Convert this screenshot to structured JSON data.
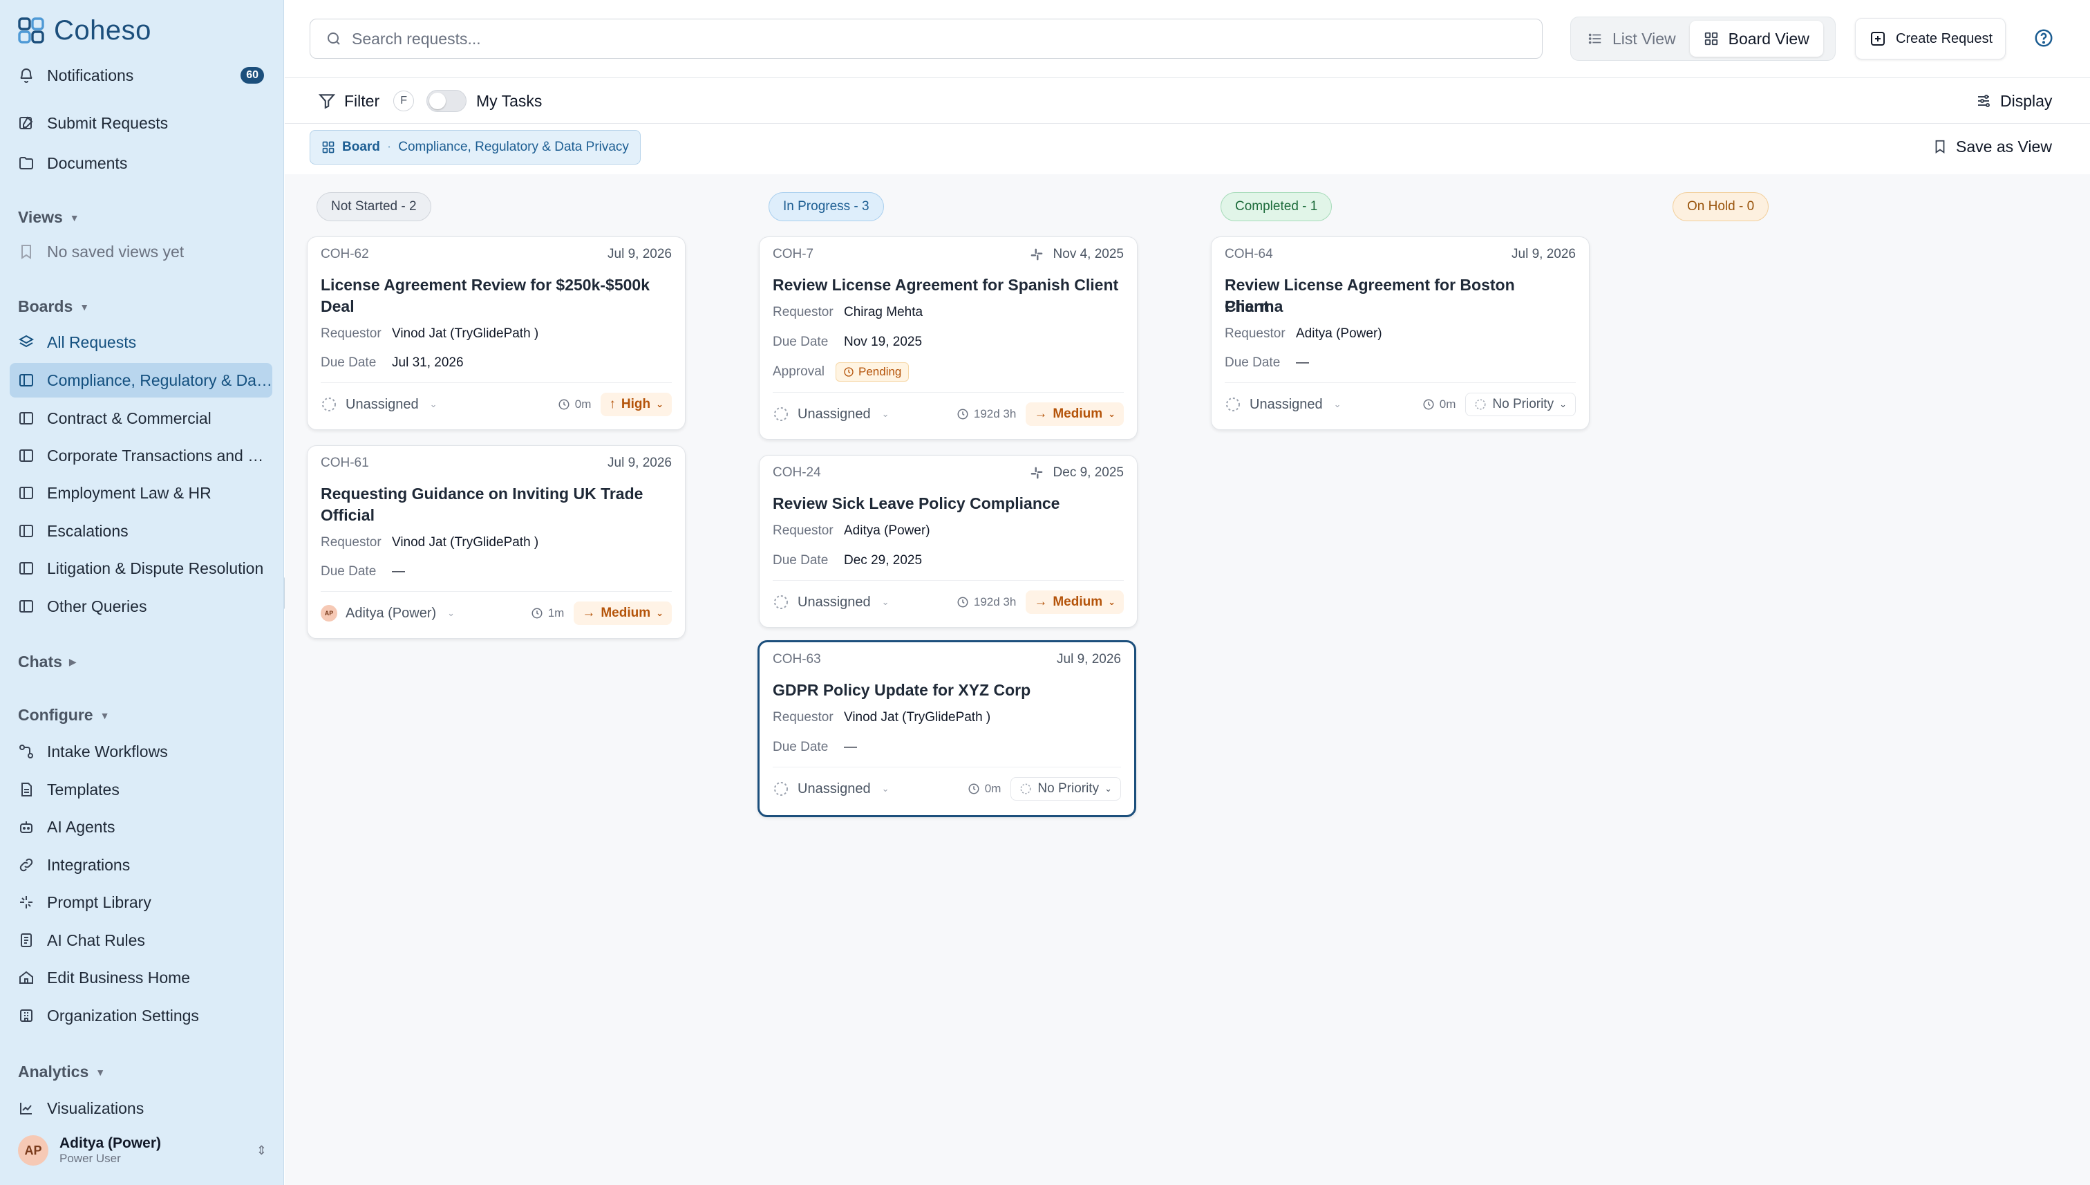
{
  "brand": {
    "name": "Coheso",
    "logo_icon": "coheso-logo-icon",
    "color": "#1c4f7c"
  },
  "sidebar": {
    "notifications": {
      "label": "Notifications",
      "count": "60"
    },
    "top_items": [
      {
        "label": "Submit Requests",
        "icon": "edit-icon"
      },
      {
        "label": "Documents",
        "icon": "folder-icon"
      }
    ],
    "views": {
      "heading": "Views",
      "empty": "No saved views yet"
    },
    "boards": {
      "heading": "Boards",
      "all_requests": "All Requests",
      "items": [
        {
          "label": "Compliance, Regulatory & Data Privacy",
          "active": true
        },
        {
          "label": "Contract & Commercial",
          "active": false
        },
        {
          "label": "Corporate Transactions and M&A",
          "active": false
        },
        {
          "label": "Employment Law & HR",
          "active": false
        },
        {
          "label": "Escalations",
          "active": false
        },
        {
          "label": "Litigation & Dispute Resolution",
          "active": false
        },
        {
          "label": "Other Queries",
          "active": false
        }
      ]
    },
    "chats": {
      "heading": "Chats"
    },
    "configure": {
      "heading": "Configure",
      "items": [
        {
          "label": "Intake Workflows",
          "icon": "workflow-icon"
        },
        {
          "label": "Templates",
          "icon": "template-icon"
        },
        {
          "label": "AI Agents",
          "icon": "robot-icon"
        },
        {
          "label": "Integrations",
          "icon": "link-icon"
        },
        {
          "label": "Prompt Library",
          "icon": "sparkle-icon"
        },
        {
          "label": "AI Chat Rules",
          "icon": "rules-icon"
        },
        {
          "label": "Edit Business Home",
          "icon": "home-icon"
        },
        {
          "label": "Organization Settings",
          "icon": "building-icon"
        }
      ]
    },
    "analytics": {
      "heading": "Analytics",
      "items": [
        {
          "label": "Visualizations",
          "icon": "chart-line-icon"
        }
      ]
    },
    "user": {
      "initials": "AP",
      "name": "Aditya (Power)",
      "role": "Power User"
    }
  },
  "topbar": {
    "search_placeholder": "Search requests...",
    "list_view": "List View",
    "board_view": "Board View",
    "create_request": "Create Request"
  },
  "filterbar": {
    "filter_label": "Filter",
    "filter_shortcut": "F",
    "my_tasks_label": "My Tasks",
    "my_tasks_on": false,
    "display_label": "Display"
  },
  "breadcrumb": {
    "root": "Board",
    "current": "Compliance, Regulatory & Data Privacy"
  },
  "save_view_label": "Save as View",
  "labels": {
    "requestor": "Requestor",
    "due_date": "Due Date",
    "approval": "Approval"
  },
  "columns": [
    {
      "label": "Not Started - 2",
      "style": "grey"
    },
    {
      "label": "In Progress - 3",
      "style": "blue"
    },
    {
      "label": "Completed - 1",
      "style": "green"
    },
    {
      "label": "On Hold - 0",
      "style": "orange"
    }
  ],
  "cards": {
    "coh62": {
      "id": "COH-62",
      "date": "Jul 9, 2026",
      "title_1": "License Agreement Review for $250k-$500k",
      "title_2": "Deal",
      "requestor": "Vinod Jat (TryGlidePath )",
      "due": "Jul 31, 2026",
      "assignee": "Unassigned",
      "time": "0m",
      "priority": "High"
    },
    "coh61": {
      "id": "COH-61",
      "date": "Jul 9, 2026",
      "title_1": "Requesting Guidance on Inviting UK Trade",
      "title_2": "Official",
      "requestor": "Vinod Jat (TryGlidePath )",
      "due": "—",
      "assignee": "Aditya (Power)",
      "assignee_initials": "AP",
      "time": "1m",
      "priority": "Medium"
    },
    "coh7": {
      "id": "COH-7",
      "date": "Nov 4, 2025",
      "title_1": "Review License Agreement for Spanish Client",
      "requestor": "Chirag Mehta",
      "due": "Nov 19, 2025",
      "approval": "Pending",
      "assignee": "Unassigned",
      "time": "192d 3h",
      "priority": "Medium"
    },
    "coh24": {
      "id": "COH-24",
      "date": "Dec 9, 2025",
      "title_1": "Review Sick Leave Policy Compliance",
      "requestor": "Aditya (Power)",
      "due": "Dec 29, 2025",
      "assignee": "Unassigned",
      "time": "192d 3h",
      "priority": "Medium"
    },
    "coh63": {
      "id": "COH-63",
      "date": "Jul 9, 2026",
      "title_1": "GDPR Policy Update for XYZ Corp",
      "requestor": "Vinod Jat (TryGlidePath )",
      "due": "—",
      "assignee": "Unassigned",
      "time": "0m",
      "priority": "No Priority"
    },
    "coh64": {
      "id": "COH-64",
      "date": "Jul 9, 2026",
      "title_1": "Review License Agreement for Boston Pharma",
      "title_2": "Client",
      "requestor": "Aditya (Power)",
      "due": "—",
      "assignee": "Unassigned",
      "time": "0m",
      "priority": "No Priority"
    }
  }
}
